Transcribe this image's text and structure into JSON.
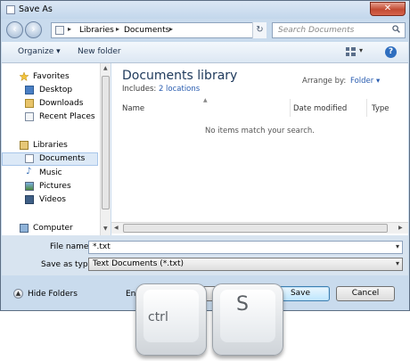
{
  "window": {
    "title": "Save As",
    "close_glyph": "✕"
  },
  "nav": {
    "back_icon": "back-arrow-icon",
    "forward_icon": "forward-arrow-icon",
    "breadcrumb": [
      "Libraries",
      "Documents"
    ],
    "refresh_glyph": "↻",
    "search_placeholder": "Search Documents"
  },
  "toolbar": {
    "organize": "Organize ▾",
    "new_folder": "New folder",
    "help": "?"
  },
  "sidebar": {
    "favorites_label": "Favorites",
    "favorites": [
      "Desktop",
      "Downloads",
      "Recent Places"
    ],
    "libraries_label": "Libraries",
    "libraries": [
      "Documents",
      "Music",
      "Pictures",
      "Videos"
    ],
    "computer_label": "Computer",
    "selected": "Documents"
  },
  "library": {
    "title": "Documents library",
    "includes_prefix": "Includes:",
    "locations": "2 locations",
    "arrange_label": "Arrange by:",
    "arrange_value": "Folder ▾"
  },
  "columns": [
    "Name",
    "Date modified",
    "Type"
  ],
  "empty_message": "No items match your search.",
  "fields": {
    "file_name_label": "File name:",
    "file_name_value": "*.txt",
    "save_as_type_label": "Save as type:",
    "save_as_type_value": "Text Documents (*.txt)"
  },
  "footer": {
    "hide_folders": "Hide Folders",
    "encoding_partial": "Enco",
    "save": "Save",
    "cancel": "Cancel"
  },
  "keys": {
    "ctrl": "ctrl",
    "s": "S"
  },
  "colors": {
    "title_bar": "#c3d7ec",
    "library_title": "#1e395b",
    "link": "#2a5db0"
  }
}
